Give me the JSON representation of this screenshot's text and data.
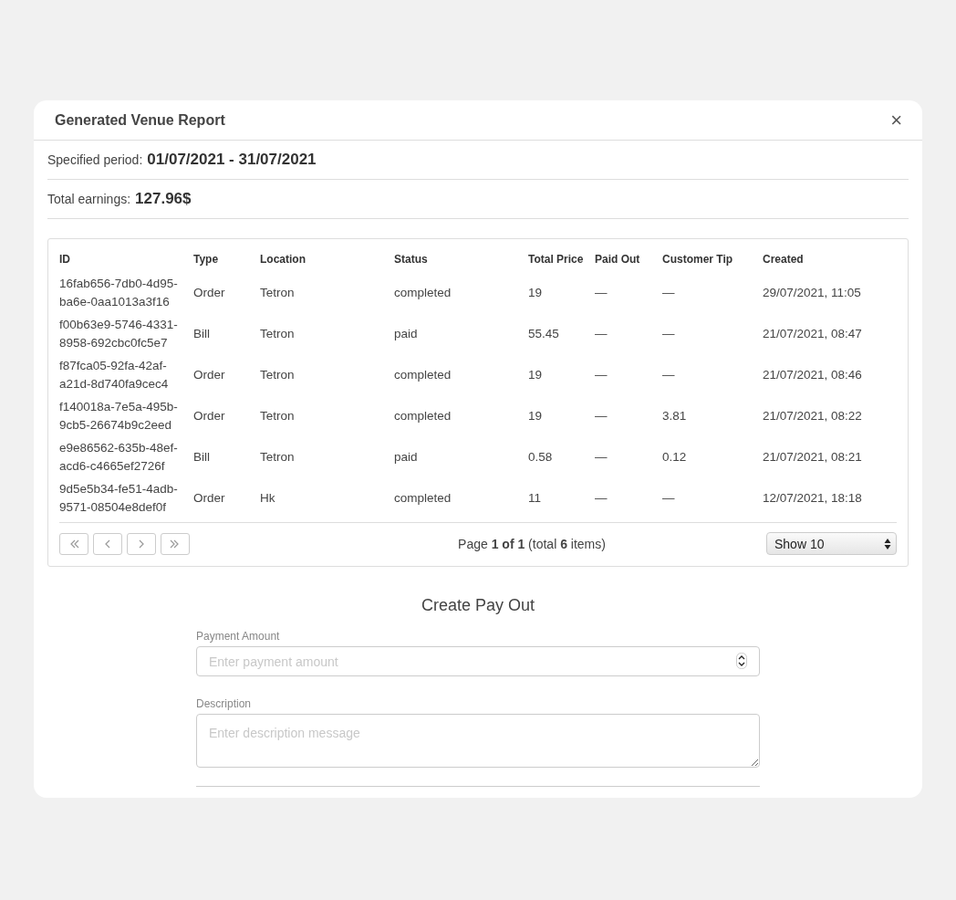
{
  "dialog": {
    "title": "Generated Venue Report",
    "close": "×"
  },
  "period": {
    "label": "Specified period:",
    "value": "01/07/2021 - 31/07/2021"
  },
  "earnings": {
    "label": "Total earnings:",
    "value": "127.96$"
  },
  "table": {
    "columns": [
      "ID",
      "Type",
      "Location",
      "Status",
      "Total Price",
      "Paid Out",
      "Customer Tip",
      "Created"
    ],
    "rows": [
      [
        "16fab656-7db0-4d95-ba6e-0aa1013a3f16",
        "Order",
        "Tetron",
        "completed",
        "19",
        "—",
        "—",
        "29/07/2021, 11:05"
      ],
      [
        "f00b63e9-5746-4331-8958-692cbc0fc5e7",
        "Bill",
        "Tetron",
        "paid",
        "55.45",
        "—",
        "—",
        "21/07/2021, 08:47"
      ],
      [
        "f87fca05-92fa-42af-a21d-8d740fa9cec4",
        "Order",
        "Tetron",
        "completed",
        "19",
        "—",
        "—",
        "21/07/2021, 08:46"
      ],
      [
        "f140018a-7e5a-495b-9cb5-26674b9c2eed",
        "Order",
        "Tetron",
        "completed",
        "19",
        "—",
        "3.81",
        "21/07/2021, 08:22"
      ],
      [
        "e9e86562-635b-48ef-acd6-c4665ef2726f",
        "Bill",
        "Tetron",
        "paid",
        "0.58",
        "—",
        "0.12",
        "21/07/2021, 08:21"
      ],
      [
        "9d5e5b34-fe51-4adb-9571-08504e8def0f",
        "Order",
        "Hk",
        "completed",
        "11",
        "—",
        "—",
        "12/07/2021, 18:18"
      ]
    ]
  },
  "pagination": {
    "buttons": [
      {
        "kind": "first",
        "disabled": true
      },
      {
        "kind": "prev",
        "disabled": true
      },
      {
        "kind": "next",
        "disabled": true
      },
      {
        "kind": "last",
        "disabled": true
      }
    ],
    "summary": "Page **1 of 1** (total **6** items)",
    "page_size": "Show 10"
  },
  "payout": {
    "title": "Create Pay Out",
    "fields": [
      {
        "kind": "number",
        "label": "Payment Amount",
        "placeholder": "Enter payment amount"
      },
      {
        "kind": "textarea",
        "label": "Description",
        "placeholder": "Enter description message"
      }
    ]
  }
}
